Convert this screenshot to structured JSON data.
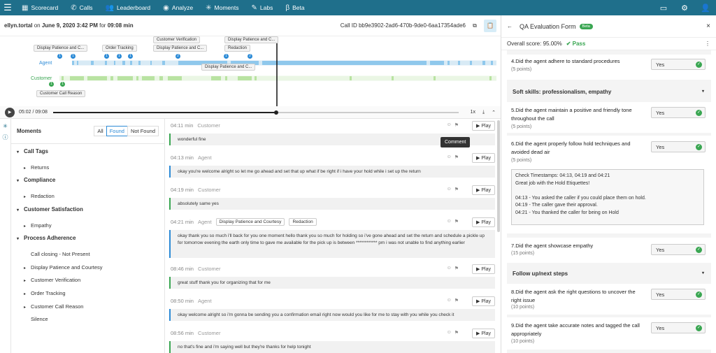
{
  "nav": {
    "items": [
      {
        "label": "Scorecard",
        "icon": "scorecard-icon"
      },
      {
        "label": "Calls",
        "icon": "phone-icon"
      },
      {
        "label": "Leaderboard",
        "icon": "people-icon"
      },
      {
        "label": "Analyze",
        "icon": "eye-icon"
      },
      {
        "label": "Moments",
        "icon": "sparkle-icon"
      },
      {
        "label": "Labs",
        "icon": "wrench-icon"
      },
      {
        "label": "Beta",
        "icon": "beta-icon"
      }
    ]
  },
  "header": {
    "agent": "ellyn.tortal",
    "on": "on",
    "datetime": "June 9, 2020 3:42 PM",
    "for": "for",
    "duration": "09:08 min",
    "call_id": "Call ID bb9e3902-2ad6-470b-9de0-6aa17354ade6"
  },
  "timeline": {
    "agent_label": "Agent",
    "customer_label": "Customer",
    "tags": [
      "Display Patience and C...",
      "Order Tracking",
      "Customer Verification",
      "Display Patience and C...",
      "Display Patience and C...",
      "Redaction",
      "Display Patience and C...",
      "Customer Call Reason"
    ],
    "dots": [
      "1",
      "1",
      "1",
      "1",
      "1",
      "2",
      "1",
      "2",
      "1",
      "1"
    ]
  },
  "player": {
    "time": "05:02 / 09:08",
    "speed": "1x",
    "progress": 0.55
  },
  "moments": {
    "title": "Moments",
    "filters": [
      "All",
      "Found",
      "Not Found"
    ],
    "tree": [
      {
        "label": "Call Tags",
        "children": [
          "Returns"
        ]
      },
      {
        "label": "Compliance",
        "children": [
          "Redaction"
        ]
      },
      {
        "label": "Customer Satisfaction",
        "children": [
          "Empathy"
        ]
      },
      {
        "label": "Process Adherence",
        "children": [
          "Call closing - Not Present",
          "Display Patience and Courtesy",
          "Customer Verification",
          "Order Tracking",
          "Customer Call Reason",
          "Silence"
        ]
      }
    ]
  },
  "transcript": {
    "play_label": "Play",
    "tooltip": "Comment",
    "rows": [
      {
        "time": "04:11 min",
        "speaker": "Customer",
        "text": "wonderful fine",
        "tags": []
      },
      {
        "time": "04:13 min",
        "speaker": "Agent",
        "text": "okay you're welcome alright so let me go ahead and set that up what if be right if i have your hold while i set up the return",
        "tags": []
      },
      {
        "time": "04:19 min",
        "speaker": "Customer",
        "text": "absolutely same yes",
        "tags": []
      },
      {
        "time": "04:21 min",
        "speaker": "Agent",
        "text": "okay thank you so much i'll back for you one moment hello thank you so much for holding so i've gone ahead and set the return and schedule a pickle up for tomorrow evening the earth only time to gave me available for the pick up is between ************ pm i was not unable to find anything earlier",
        "tags": [
          "Display Patience and Courtesy",
          "Redaction"
        ]
      },
      {
        "time": "08:46 min",
        "speaker": "Customer",
        "text": "great stuff thank you for organizing that for me",
        "tags": []
      },
      {
        "time": "08:50 min",
        "speaker": "Agent",
        "text": "okay welcome alright so i'm gonna be sending you a confirmation email right now would you like for me to stay with you while you check it",
        "tags": []
      },
      {
        "time": "08:56 min",
        "speaker": "Customer",
        "text": "no that's fine and i'm saying well but they're thanks for help tonight",
        "tags": []
      }
    ]
  },
  "qa": {
    "title": "QA Evaluation Form",
    "beta": "Beta",
    "overall_label": "Overall score: 95.00%",
    "pass": "Pass",
    "answer": "Yes",
    "questions": [
      {
        "text": "4.Did the agent adhere to standard procedures",
        "points": "(5 points)"
      },
      {
        "text": "5.Did the agent maintain a positive and friendly tone throughout the call",
        "points": "(5 points)"
      },
      {
        "text": "6.Did the agent properly follow hold techniques and avoided dead air",
        "points": "(5 points)"
      },
      {
        "text": "7.Did the agent showcase empathy",
        "points": "(15 points)"
      },
      {
        "text": "8.Did the agent ask the right questions to uncover the right issue",
        "points": "(10 points)"
      },
      {
        "text": "9.Did the agent take accurate notes and tagged the call appropriately",
        "points": "(10 points)"
      }
    ],
    "sections": [
      "Soft skills: professionalism, empathy",
      "Follow up/next steps"
    ],
    "comment_lines": [
      "Check Timestamps: 04:13, 04:19 and 04:21",
      "Great job with the Hold Etiquettes!",
      "",
      "04:13 - You asked the caller if you could place them on hold.",
      "04:19 - The caller gave their approval.",
      "04:21 -  You thanked the caller for being on Hold"
    ]
  }
}
